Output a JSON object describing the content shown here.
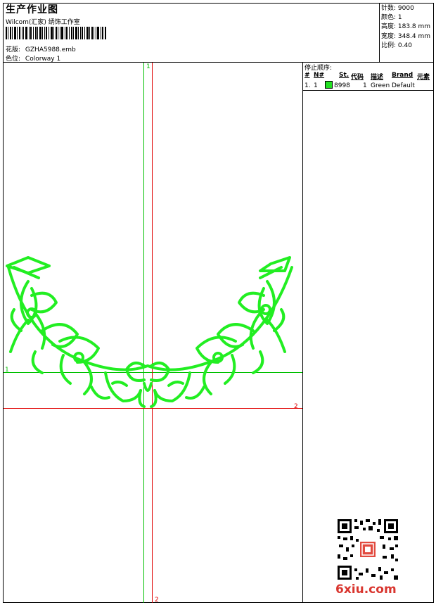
{
  "header": {
    "title": "生产作业图",
    "company": "Wilcom(汇家) 绣饰工作室",
    "pattern_label": "花版:",
    "pattern_value": "GZHA5988.emb",
    "colorway_label": "色位:",
    "colorway_value": "Colorway 1"
  },
  "stats": {
    "stitches": "针数: 9000",
    "colors": "颜色: 1",
    "height": "高度: 183.8 mm",
    "width": "宽度: 348.4 mm",
    "scale": "比例: 0.40"
  },
  "stop_sequence": {
    "title": "停止顺序:",
    "columns": [
      "#",
      "N#",
      "St.",
      "代码",
      "描述",
      "Brand",
      "元素"
    ],
    "rows": [
      {
        "num": "1.",
        "needle": "1",
        "color_code": "8998",
        "stitches": "1",
        "description": "Green",
        "brand": "Default",
        "swatch_color": "#22e022"
      }
    ]
  },
  "guides": {
    "green_vertical_label": "1",
    "green_horizontal_label": "1",
    "red_horizontal_label": "2",
    "red_vertical_label": "2",
    "green_color": "#00c000",
    "red_color": "#e00000"
  },
  "design_color": "#22ee22",
  "watermark": "6xiu.com",
  "qr_icon": "qr-code-icon"
}
